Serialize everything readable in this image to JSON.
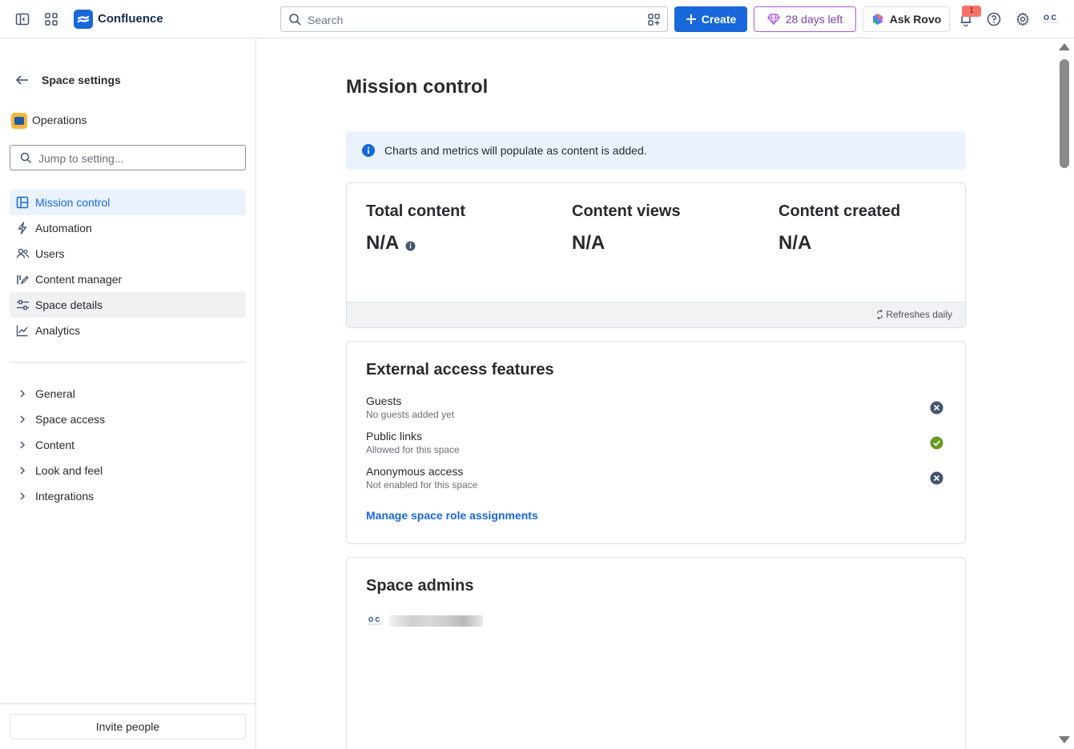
{
  "app": {
    "name": "Confluence"
  },
  "search": {
    "placeholder": "Search"
  },
  "topbar": {
    "create_label": "Create",
    "trial_label": "28 days left",
    "rovo_label": "Ask Rovo",
    "notification_count": "1",
    "avatar_initials": "O C"
  },
  "sidebar": {
    "title": "Space settings",
    "space_name": "Operations",
    "jump_placeholder": "Jump to setting...",
    "items": [
      {
        "label": "Mission control",
        "icon": "layout-icon"
      },
      {
        "label": "Automation",
        "icon": "lightning-icon"
      },
      {
        "label": "Users",
        "icon": "people-icon"
      },
      {
        "label": "Content manager",
        "icon": "edit-icon"
      },
      {
        "label": "Space details",
        "icon": "settings-sliders-icon"
      },
      {
        "label": "Analytics",
        "icon": "chart-line-icon"
      }
    ],
    "sections": [
      "General",
      "Space access",
      "Content",
      "Look and feel",
      "Integrations"
    ],
    "invite_label": "Invite people"
  },
  "main": {
    "title": "Mission control",
    "info_banner": "Charts and metrics will populate as content is added.",
    "metrics": [
      {
        "title": "Total content",
        "value": "N/A"
      },
      {
        "title": "Content views",
        "value": "N/A"
      },
      {
        "title": "Content created",
        "value": "N/A"
      }
    ],
    "refresh_label": "Refreshes daily",
    "external": {
      "title": "External access features",
      "features": [
        {
          "name": "Guests",
          "desc": "No guests added yet",
          "status": "disabled"
        },
        {
          "name": "Public links",
          "desc": "Allowed for this space",
          "status": "enabled"
        },
        {
          "name": "Anonymous access",
          "desc": "Not enabled for this space",
          "status": "disabled"
        }
      ],
      "manage_link": "Manage space role assignments"
    },
    "admins": {
      "title": "Space admins",
      "avatar_initials": "O C"
    }
  },
  "colors": {
    "accent": "#1868db",
    "success": "#6a9a23",
    "neutral_icon": "#44546f"
  }
}
